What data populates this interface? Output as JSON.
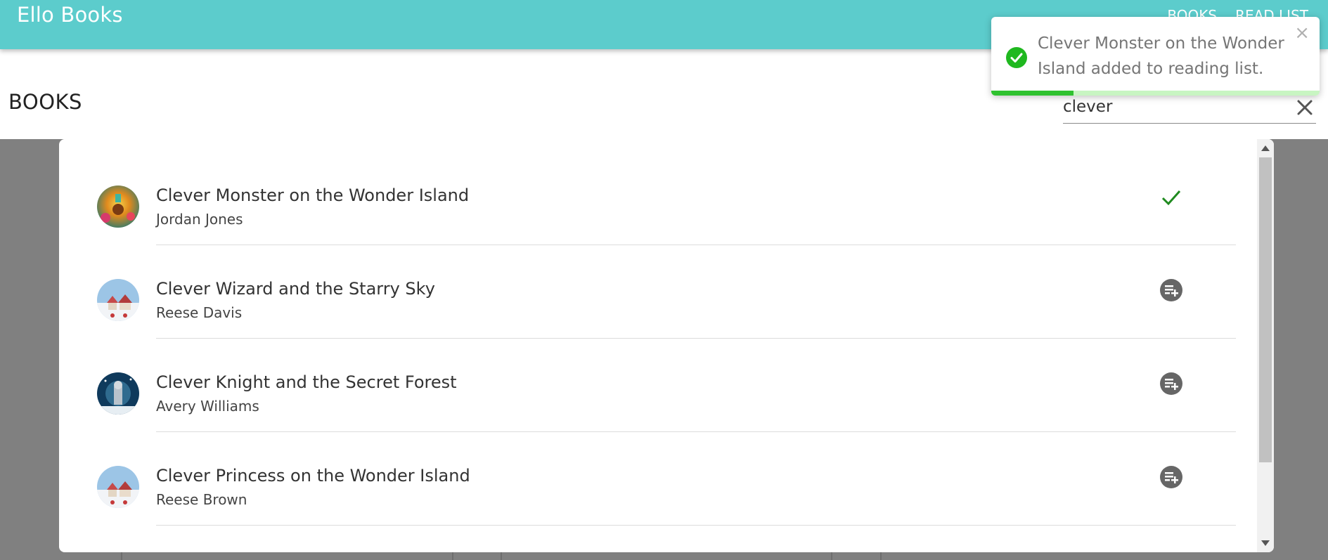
{
  "app": {
    "title": "Ello Books"
  },
  "nav": [
    {
      "label": "BOOKS"
    },
    {
      "label": "READ LIST"
    }
  ],
  "page": {
    "heading": "BOOKS"
  },
  "search": {
    "value": "clever",
    "placeholder": ""
  },
  "books": [
    {
      "title": "Clever Monster on the Wonder Island",
      "author": "Jordan Jones",
      "in_list": true,
      "action_icon": "check-icon"
    },
    {
      "title": "Clever Wizard and the Starry Sky",
      "author": "Reese Davis",
      "in_list": false,
      "action_icon": "playlist-add-icon"
    },
    {
      "title": "Clever Knight and the Secret Forest",
      "author": "Avery Williams",
      "in_list": false,
      "action_icon": "playlist-add-icon"
    },
    {
      "title": "Clever Princess on the Wonder Island",
      "author": "Reese Brown",
      "in_list": false,
      "action_icon": "playlist-add-icon"
    }
  ],
  "toast": {
    "message": "Clever Monster on the Wonder Island added to reading list.",
    "progress": 0.25,
    "icon": "check-circle-icon"
  },
  "colors": {
    "appbar": "#5ccccc",
    "success": "#2fc22f",
    "check": "#1f8a1f",
    "action_icon": "#666666",
    "backdrop": "#808080"
  }
}
